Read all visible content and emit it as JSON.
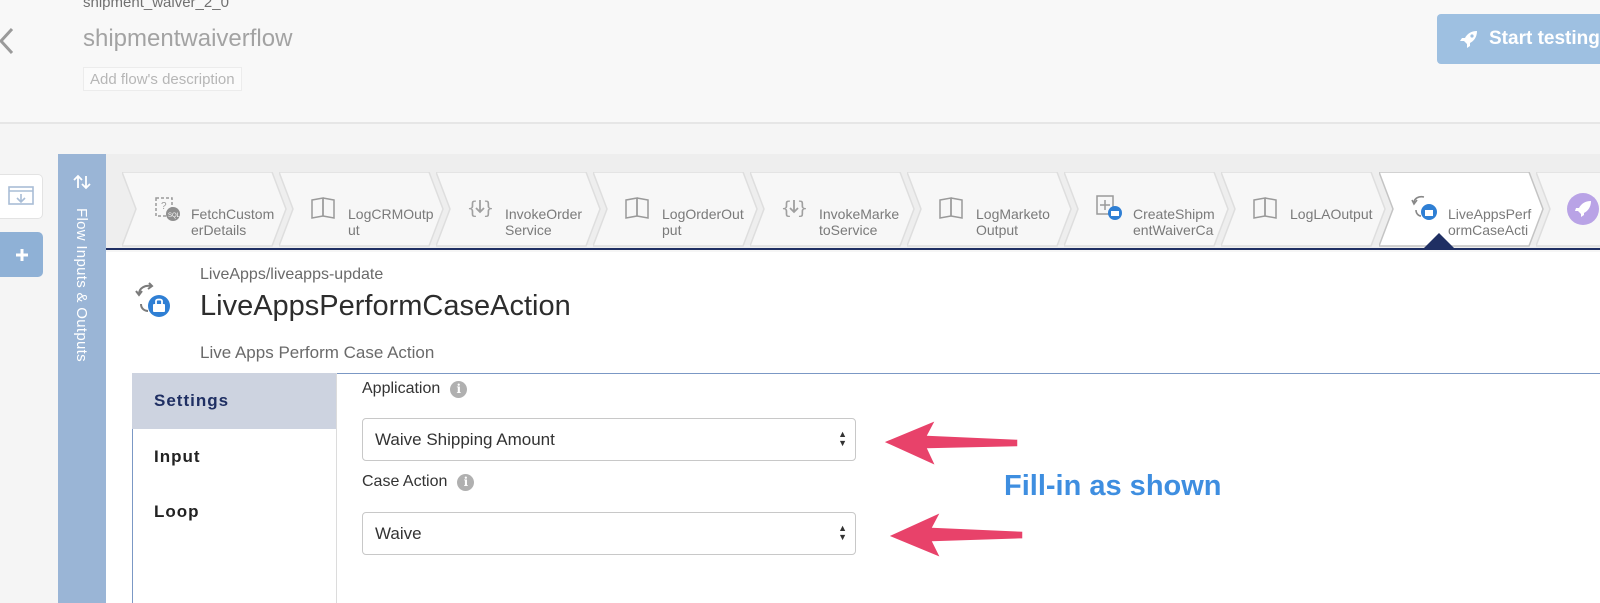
{
  "header": {
    "flow_name": "shipment_waiver_2_0",
    "flow_title": "shipmentwaiverflow",
    "description_placeholder": "Add flow's description",
    "start_button": "Start testing"
  },
  "io_strip": {
    "label": "Flow Inputs & Outputs"
  },
  "steps": [
    {
      "label": "FetchCustom\nerDetails",
      "icon": "sql-query-icon"
    },
    {
      "label": "LogCRMOutp\nut",
      "icon": "book-icon"
    },
    {
      "label": "InvokeOrder\nService",
      "icon": "invoke-service-icon"
    },
    {
      "label": "LogOrderOut\nput",
      "icon": "book-icon"
    },
    {
      "label": "InvokeMarke\ntoService",
      "icon": "invoke-service-icon"
    },
    {
      "label": "LogMarketo\nOutput",
      "icon": "book-icon"
    },
    {
      "label": "CreateShipm\nentWaiverCa",
      "icon": "create-case-icon"
    },
    {
      "label": "LogLAOutput",
      "icon": "book-icon"
    },
    {
      "label": "LiveAppsPerf\normCaseActi",
      "icon": "case-action-icon",
      "active": true
    }
  ],
  "activity": {
    "path": "LiveApps/liveapps-update",
    "title": "LiveAppsPerformCaseAction",
    "subtitle": "Live Apps Perform Case Action"
  },
  "side_tabs": [
    {
      "label": "Settings",
      "active": true
    },
    {
      "label": "Input"
    },
    {
      "label": "Loop"
    }
  ],
  "fields": {
    "application": {
      "label": "Application",
      "value": "Waive Shipping Amount"
    },
    "case_action": {
      "label": "Case Action",
      "value": "Waive"
    }
  },
  "annotation": {
    "text": "Fill-in as shown",
    "arrow_color": "#e8426a",
    "text_color": "#3e8ee0"
  },
  "colors": {
    "accent": "#1f2f63",
    "strip": "#9ab5d6",
    "button": "#9ec0e1"
  }
}
